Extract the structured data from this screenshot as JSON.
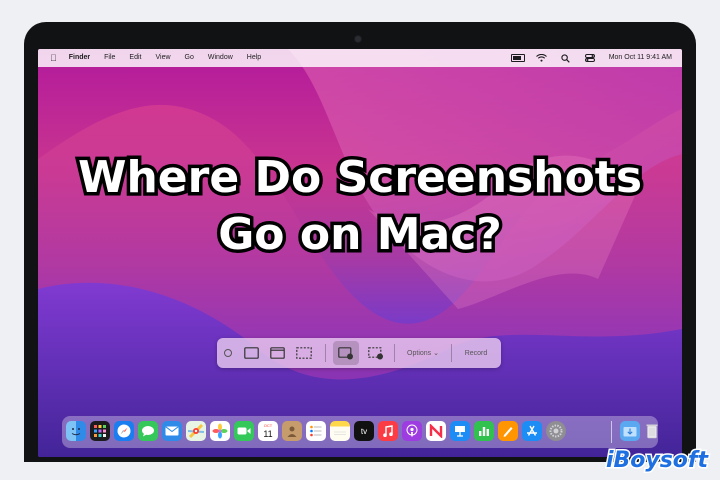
{
  "menubar": {
    "apple": "",
    "items": [
      "Finder",
      "File",
      "Edit",
      "View",
      "Go",
      "Window",
      "Help"
    ],
    "clock": "Mon Oct 11  9:41 AM"
  },
  "headline": {
    "line1": "Where Do Screenshots",
    "line2": "Go on Mac?"
  },
  "toolbar": {
    "options_label": "Options ⌄",
    "record_label": "Record"
  },
  "dock": {
    "calendar_month": "OCT",
    "calendar_day": "11",
    "tv_label": "tv"
  },
  "watermark": "iBoysoft",
  "colors": {
    "wallpaper_top": "#b21a9c",
    "wallpaper_bottom": "#3f2aa6",
    "toolbar_bg": "#e8c8ee",
    "watermark": "#1e6fe0"
  }
}
